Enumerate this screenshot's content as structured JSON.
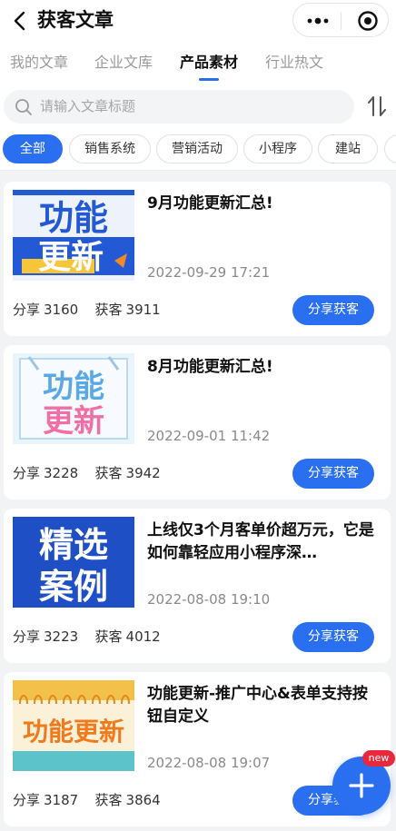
{
  "header": {
    "title": "获客文章"
  },
  "tabs": [
    {
      "label": "我的文章"
    },
    {
      "label": "企业文库"
    },
    {
      "label": "产品素材",
      "active": true
    },
    {
      "label": "行业热文"
    }
  ],
  "search": {
    "placeholder": "请输入文章标题"
  },
  "categories": [
    "全部",
    "销售系统",
    "营销活动",
    "小程序",
    "建站"
  ],
  "articles": [
    {
      "title": "9月功能更新汇总!",
      "date": "2022-09-29 17:21",
      "share_label": "分享",
      "share_count": "3160",
      "leads_label": "获客",
      "leads_count": "3911",
      "button": "分享获客",
      "thumb_text": [
        "功能",
        "更新"
      ]
    },
    {
      "title": "8月功能更新汇总!",
      "date": "2022-09-01 11:42",
      "share_label": "分享",
      "share_count": "3228",
      "leads_label": "获客",
      "leads_count": "3942",
      "button": "分享获客",
      "thumb_text": [
        "功能",
        "更新"
      ]
    },
    {
      "title": "上线仅3个月客单价超万元，它是如何靠轻应用小程序深…",
      "date": "2022-08-08 19:10",
      "share_label": "分享",
      "share_count": "3223",
      "leads_label": "获客",
      "leads_count": "4012",
      "button": "分享获客",
      "thumb_text": [
        "精选",
        "案例"
      ]
    },
    {
      "title": "功能更新-推广中心&表单支持按钮自定义",
      "date": "2022-08-08 19:07",
      "share_label": "分享",
      "share_count": "3187",
      "leads_label": "获客",
      "leads_count": "3864",
      "button": "分享获客",
      "thumb_text": [
        "功能更新"
      ]
    }
  ],
  "fab": {
    "badge": "new"
  },
  "colors": {
    "accent": "#2a6ff0",
    "badge": "#e8283b"
  }
}
